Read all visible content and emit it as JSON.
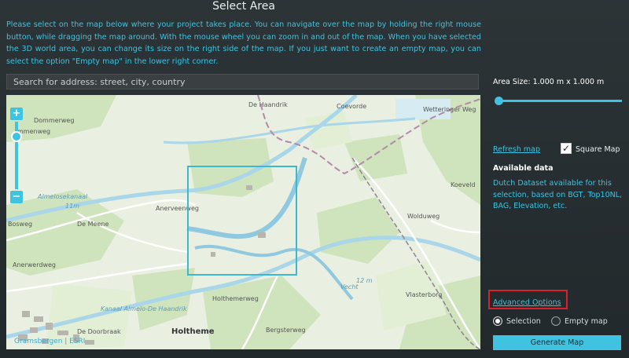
{
  "header": {
    "title": "Select Area"
  },
  "intro": {
    "text": "Please select on the map below where your project takes place. You can navigate over the map by holding the right mouse button, while dragging the map around. With the mouse wheel you can zoom in and out of the map. When you have selected the 3D world area, you can change its size on the right side of the map. If you just want to create an empty map, you can select the option \"Empty map\" in the lower right corner."
  },
  "search": {
    "placeholder": "Search for address: street, city, country",
    "value": ""
  },
  "map": {
    "zoom_in": "+",
    "zoom_out": "−",
    "credit": "Gramsbergen | ESRI",
    "labels": {
      "l1": "Dommerweg",
      "l2": "mmenweg",
      "l3": "Bosweg",
      "l4": "Almelosekanaal",
      "l5": "De Meene",
      "l6": "Anerveenweg",
      "l7": "11m",
      "l8": "Anerwerdweg",
      "l9": "Kanaal Almelo-De Haandrik",
      "l10": "Holthemerweg",
      "l11": "Holtheme",
      "l12": "De Doorbraak",
      "l13": "Gramsbergen",
      "l14": "Bergsterweg",
      "l15": "Vecht",
      "l16": "12 m",
      "l17": "Wolduweg",
      "l18": "Vlasterborg",
      "l19": "Wetteringer Weg",
      "l20": "Coevorde",
      "l21": "De Haandrik",
      "l22": "Koeveld"
    }
  },
  "panel": {
    "area_size": "Area Size: 1.000 m x 1.000 m",
    "area_slider_fraction": 0.0,
    "refresh_map": "Refresh map",
    "square_map_label": "Square Map",
    "square_map_checked": true,
    "available_title": "Available data",
    "available_text": "Dutch Dataset available for this selection, based on BGT, Top10NL, BAG, Elevation, etc.",
    "advanced_options": "Advanced Options",
    "radio_selection": "Selection",
    "radio_empty": "Empty map",
    "selected_mode": "Selection",
    "generate": "Generate Map"
  },
  "colors": {
    "accent": "#3fc3e0",
    "highlight_red": "#d9232b",
    "background": "#2a3134"
  }
}
